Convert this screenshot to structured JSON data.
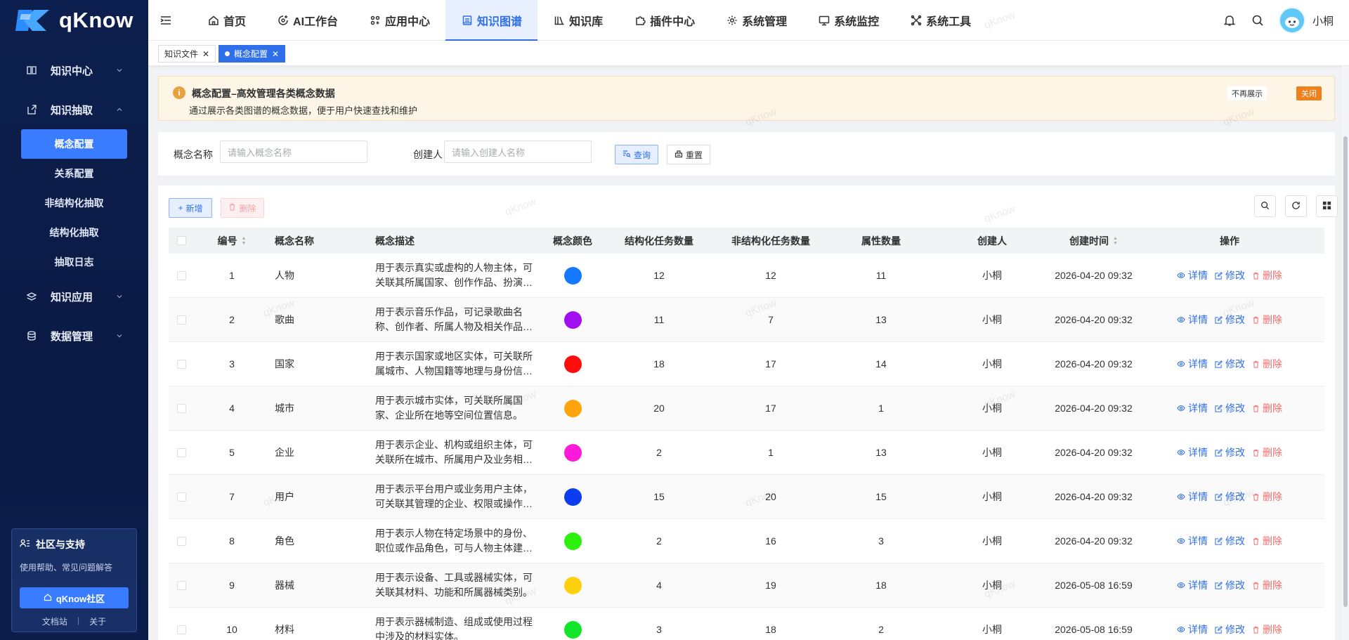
{
  "app": {
    "name": "qKnow"
  },
  "sidebar": {
    "groups": [
      {
        "label": "知识中心",
        "icon": "book-icon",
        "expanded": false,
        "items": []
      },
      {
        "label": "知识抽取",
        "icon": "extract-icon",
        "expanded": true,
        "items": [
          {
            "label": "概念配置",
            "active": true
          },
          {
            "label": "关系配置",
            "active": false
          },
          {
            "label": "非结构化抽取",
            "active": false
          },
          {
            "label": "结构化抽取",
            "active": false
          },
          {
            "label": "抽取日志",
            "active": false
          }
        ]
      },
      {
        "label": "知识应用",
        "icon": "layers-icon",
        "expanded": false,
        "items": []
      },
      {
        "label": "数据管理",
        "icon": "database-icon",
        "expanded": false,
        "items": []
      }
    ],
    "community": {
      "title": "社区与支持",
      "desc": "使用帮助、常见问题解答",
      "button": "qKnow社区",
      "link_docs": "文档站",
      "separator": "|",
      "link_about": "关于"
    }
  },
  "topnav": {
    "items": [
      {
        "label": "首页",
        "icon": "home-icon",
        "active": false
      },
      {
        "label": "AI工作台",
        "icon": "ai-icon",
        "active": false
      },
      {
        "label": "应用中心",
        "icon": "apps-icon",
        "active": false
      },
      {
        "label": "知识图谱",
        "icon": "graph-icon",
        "active": true
      },
      {
        "label": "知识库",
        "icon": "library-icon",
        "active": false
      },
      {
        "label": "插件中心",
        "icon": "plugin-icon",
        "active": false
      },
      {
        "label": "系统管理",
        "icon": "settings-icon",
        "active": false
      },
      {
        "label": "系统监控",
        "icon": "monitor-icon",
        "active": false
      },
      {
        "label": "系统工具",
        "icon": "tools-icon",
        "active": false
      }
    ],
    "username": "小桐"
  },
  "tabs": [
    {
      "label": "知识文件",
      "active": false
    },
    {
      "label": "概念配置",
      "active": true
    }
  ],
  "alert": {
    "title": "概念配置–高效管理各类概念数据",
    "desc": "通过展示各类图谱的概念数据，便于用户快速查找和维护",
    "no_more": "不再展示",
    "close": "关闭"
  },
  "search": {
    "name_label": "概念名称",
    "name_placeholder": "请输入概念名称",
    "creator_label": "创建人",
    "creator_placeholder": "请输入创建人名称",
    "query": "查询",
    "reset": "重置"
  },
  "toolbar": {
    "add": "新增",
    "delete": "删除"
  },
  "table": {
    "columns": [
      "编号",
      "概念名称",
      "概念描述",
      "概念颜色",
      "结构化任务数量",
      "非结构化任务数量",
      "属性数量",
      "创建人",
      "创建时间",
      "操作"
    ],
    "ops": {
      "detail": "详情",
      "edit": "修改",
      "delete": "删除"
    },
    "rows": [
      {
        "no": "1",
        "name": "人物",
        "desc": "用于表示真实或虚构的人物主体，可关联其所属国家、创作作品、扮演…",
        "color": "#1677ff",
        "struct": "12",
        "unstruct": "12",
        "attrs": "11",
        "creator": "小桐",
        "time": "2026-04-20 09:32"
      },
      {
        "no": "2",
        "name": "歌曲",
        "desc": "用于表示音乐作品，可记录歌曲名称、创作者、所属人物及相关作品…",
        "color": "#a10ff0",
        "struct": "11",
        "unstruct": "7",
        "attrs": "13",
        "creator": "小桐",
        "time": "2026-04-20 09:32"
      },
      {
        "no": "3",
        "name": "国家",
        "desc": "用于表示国家或地区实体，可关联所属城市、人物国籍等地理与身份信…",
        "color": "#ff0d0d",
        "struct": "18",
        "unstruct": "17",
        "attrs": "14",
        "creator": "小桐",
        "time": "2026-04-20 09:32"
      },
      {
        "no": "4",
        "name": "城市",
        "desc": "用于表示城市实体，可关联所属国家、企业所在地等空间位置信息。",
        "color": "#ffa40d",
        "struct": "20",
        "unstruct": "17",
        "attrs": "1",
        "creator": "小桐",
        "time": "2026-04-20 09:32"
      },
      {
        "no": "5",
        "name": "企业",
        "desc": "用于表示企业、机构或组织主体，可关联所在城市、所属用户及业务相…",
        "color": "#ff1ad9",
        "struct": "2",
        "unstruct": "1",
        "attrs": "13",
        "creator": "小桐",
        "time": "2026-04-20 09:32"
      },
      {
        "no": "7",
        "name": "用户",
        "desc": "用于表示平台用户或业务用户主体，可关联其管理的企业、权限或操作…",
        "color": "#0d3df0",
        "struct": "15",
        "unstruct": "20",
        "attrs": "15",
        "creator": "小桐",
        "time": "2026-04-20 09:32"
      },
      {
        "no": "8",
        "name": "角色",
        "desc": "用于表示人物在特定场景中的身份、职位或作品角色，可与人物主体建…",
        "color": "#2ef00d",
        "struct": "2",
        "unstruct": "16",
        "attrs": "3",
        "creator": "小桐",
        "time": "2026-04-20 09:32"
      },
      {
        "no": "9",
        "name": "器械",
        "desc": "用于表示设备、工具或器械实体，可关联其材料、功能和所属器械类别。",
        "color": "#ffd00d",
        "struct": "4",
        "unstruct": "19",
        "attrs": "18",
        "creator": "小桐",
        "time": "2026-05-08 16:59"
      },
      {
        "no": "10",
        "name": "材料",
        "desc": "用于表示器械制造、组成或使用过程中涉及的材料实体。",
        "color": "#13e62a",
        "struct": "3",
        "unstruct": "18",
        "attrs": "2",
        "creator": "小桐",
        "time": "2026-05-08 16:59"
      }
    ]
  },
  "watermark": "qKnow"
}
